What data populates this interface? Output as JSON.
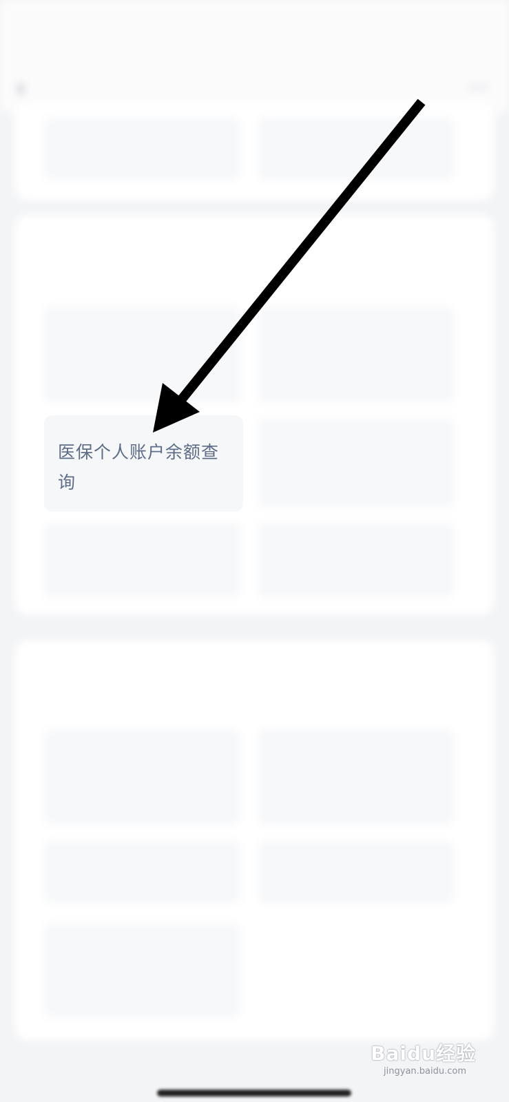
{
  "status_bar": {
    "time": "",
    "icons": ""
  },
  "nav": {
    "title": "",
    "back_icon": "chevron-left-icon",
    "more_icon": "more-icon"
  },
  "sections": {
    "top": {
      "tiles": [
        "",
        ""
      ]
    },
    "middle": {
      "title": "",
      "tiles": [
        "",
        "",
        "",
        "",
        ""
      ]
    },
    "bottom": {
      "title": "",
      "tiles": [
        "",
        "",
        "",
        "",
        ""
      ]
    }
  },
  "focus_tile": {
    "label": "医保个人账户余额查询"
  },
  "watermark": {
    "brand": "Baidu经验",
    "url": "jingyan.baidu.com"
  }
}
